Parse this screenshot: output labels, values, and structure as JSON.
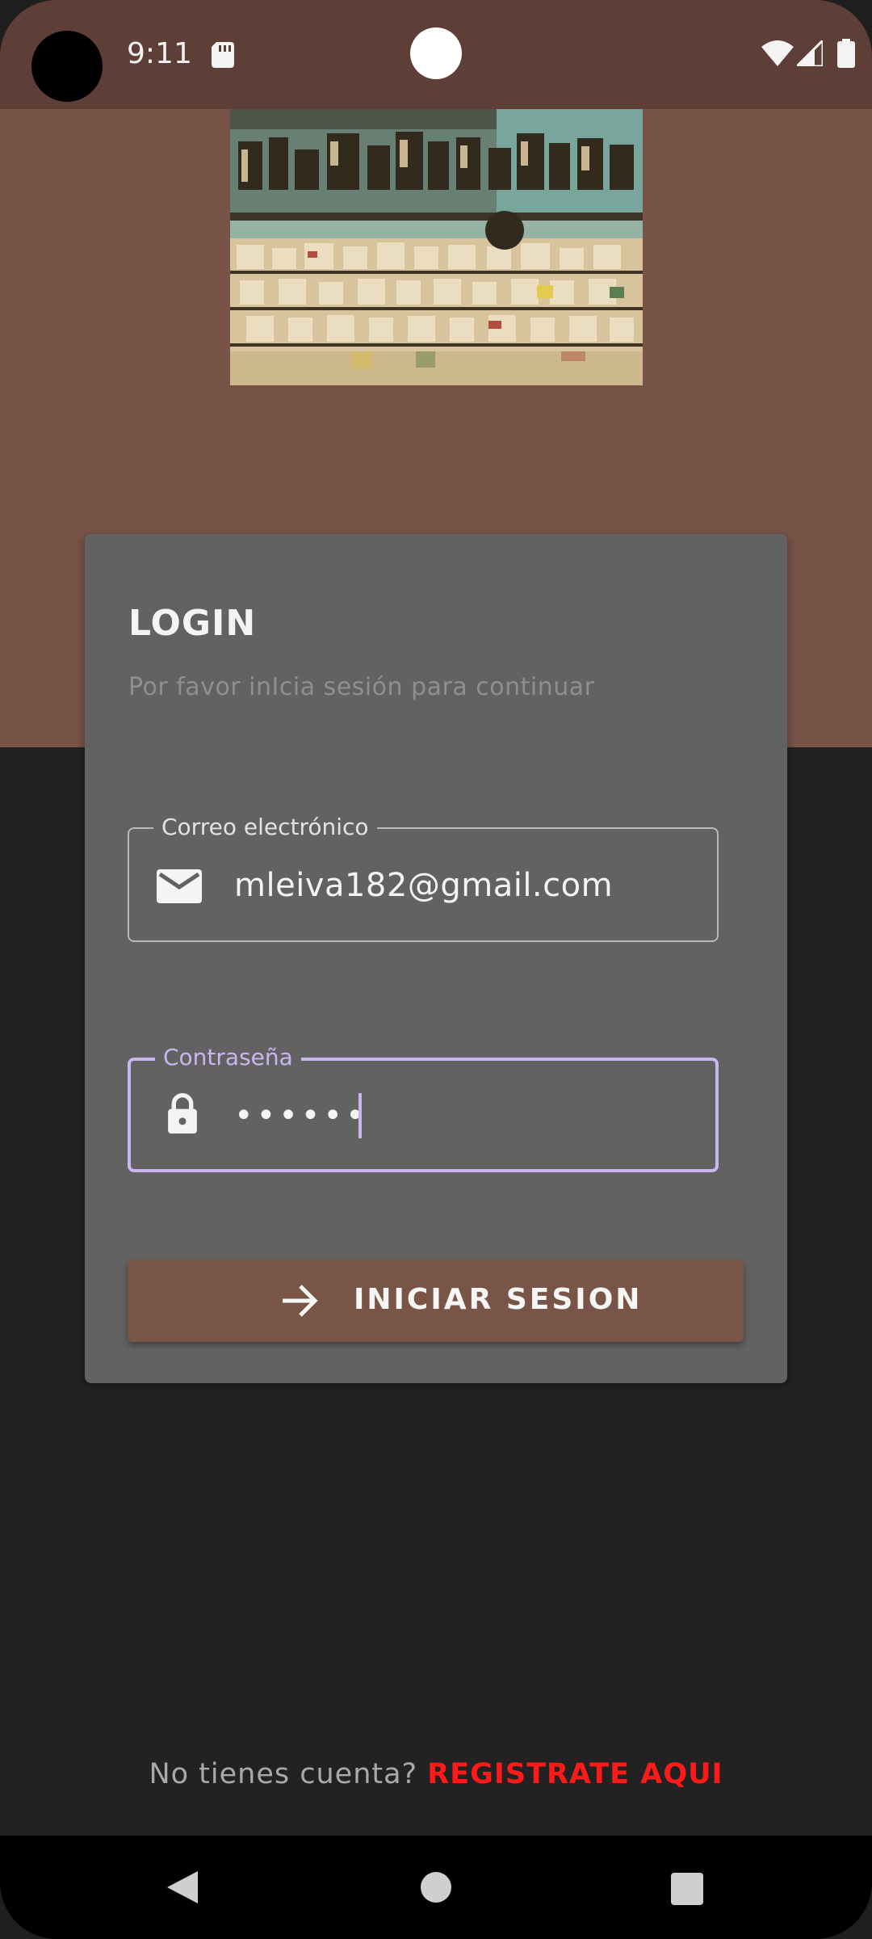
{
  "status_bar": {
    "time": "9:11",
    "icons": [
      "sd-card-icon",
      "wifi-icon",
      "cell-signal-icon",
      "battery-icon"
    ]
  },
  "header_image": {
    "description_icon": "record-store-photo"
  },
  "login": {
    "title": "LOGIN",
    "subtitle": "Por favor inIcia sesión para continuar",
    "email": {
      "label": "Correo  electrónico",
      "value": "mleiva182@gmail.com",
      "icon": "email-icon"
    },
    "password": {
      "label": "Contraseña",
      "value": "••••••",
      "icon": "lock-icon"
    },
    "button": {
      "label": "INICIAR SESION",
      "icon": "arrow-right-icon"
    }
  },
  "register": {
    "prompt": "No tienes cuenta?",
    "link": "REGISTRATE AQUI"
  },
  "nav_bar": {
    "icons": [
      "back-icon",
      "home-icon",
      "recents-icon"
    ]
  },
  "colors": {
    "status_bar": "#5e3f37",
    "brand": "#785347",
    "card": "#626262",
    "background": "#222222",
    "focus_accent": "#c9b6ef",
    "register_link": "#ff1a1a"
  }
}
